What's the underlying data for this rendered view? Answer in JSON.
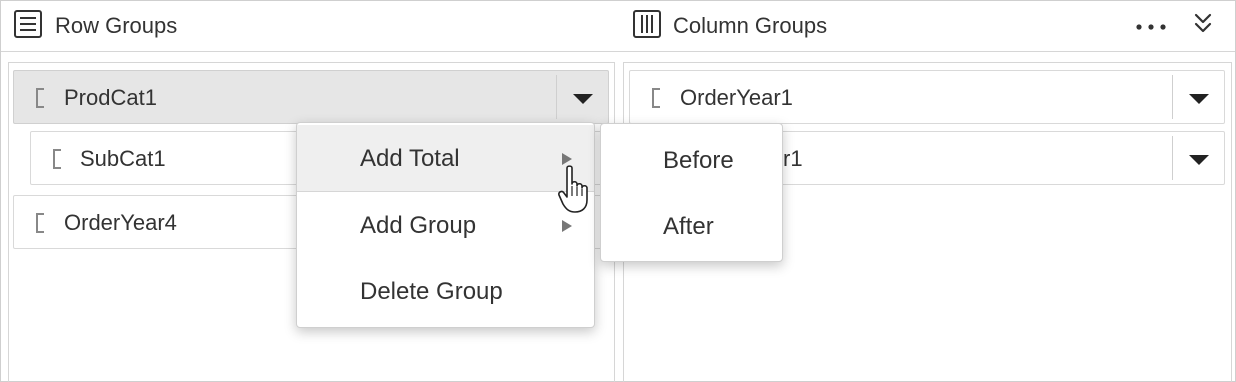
{
  "header": {
    "row_groups_title": "Row Groups",
    "row_groups_icon": "list-lines-icon",
    "column_groups_title": "Column Groups",
    "column_groups_icon": "columns-icon",
    "more_icon": "more-horizontal-icon",
    "collapse_icon": "chevron-double-down-icon"
  },
  "row_groups": {
    "items": [
      {
        "label": "ProdCat1",
        "selected": true
      },
      {
        "label": "SubCat1"
      },
      {
        "label": "OrderYear4"
      }
    ]
  },
  "column_groups": {
    "items": [
      {
        "label": "OrderYear1"
      },
      {
        "label": "r1"
      }
    ]
  },
  "context_menu": {
    "items": [
      {
        "label": "Add Total",
        "has_submenu": true,
        "hover": true
      },
      {
        "label": "Add Group",
        "has_submenu": true
      },
      {
        "label": "Delete Group"
      }
    ]
  },
  "submenu": {
    "items": [
      {
        "label": "Before"
      },
      {
        "label": "After"
      }
    ]
  },
  "colors": {
    "selected_bg": "#e6e6e6",
    "hover_bg": "#efefef",
    "border": "#d6d6d6",
    "text": "#333333"
  }
}
